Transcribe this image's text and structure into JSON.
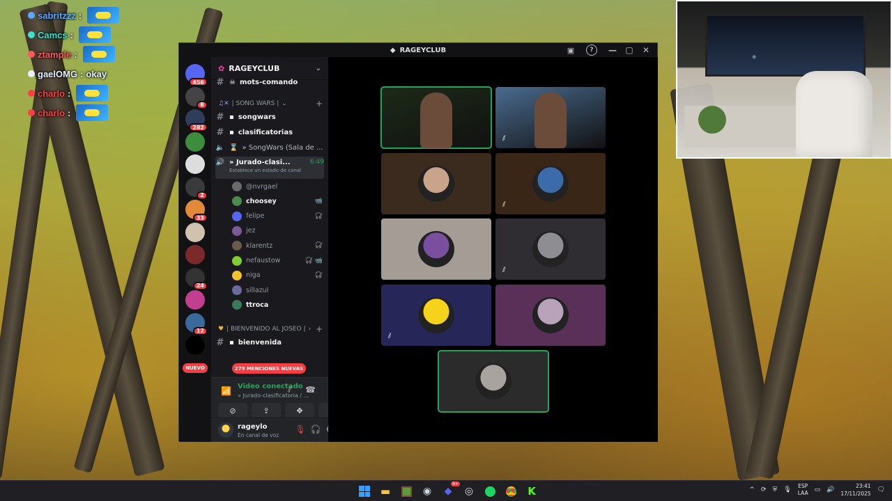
{
  "overlay_chat": [
    {
      "user": "sabritzzz",
      "message": "",
      "emote": true,
      "color": "#5aa8ff"
    },
    {
      "user": "Camcs",
      "message": "",
      "emote": true,
      "color": "#3fe0d0"
    },
    {
      "user": "ztample",
      "message": "",
      "emote": true,
      "color": "#ff5a5a"
    },
    {
      "user": "gaelOMG",
      "message": "okay",
      "emote": false,
      "color": "#e6f0ff"
    },
    {
      "user": "charlo",
      "message": "",
      "emote": true,
      "color": "#ff4040"
    },
    {
      "user": "charlo",
      "message": "",
      "emote": true,
      "color": "#ff4040"
    }
  ],
  "window": {
    "title": "RAGEYCLUB"
  },
  "servers": [
    {
      "badge": "456"
    },
    {
      "badge": "8"
    },
    {
      "badge": "282"
    },
    {
      "badge": ""
    },
    {
      "badge": ""
    },
    {
      "badge": "2"
    },
    {
      "badge": "33"
    },
    {
      "badge": ""
    },
    {
      "badge": ""
    },
    {
      "badge": "24"
    },
    {
      "badge": ""
    },
    {
      "badge": "12"
    },
    {
      "badge": ""
    }
  ],
  "new_label": "NUEVO",
  "guild": {
    "name": "RAGEYCLUB"
  },
  "channels": {
    "mots": "mots-comando",
    "cat_songwars": "| SONG WARS |",
    "songwars": "songwars",
    "clasificatorias": "clasificatorias",
    "songwars_sala": "» SongWars (Sala de ...",
    "jurado": "» Jurado-clasi...",
    "jurado_time": "6:49",
    "jurado_status": "Establece un estado de canal",
    "cat_bienvenido": "| BIENVENIDO AL JOSEO |",
    "bienvenida": "bienvenida"
  },
  "voice_users": [
    {
      "name": "@nvrgael",
      "on": false,
      "icons": ""
    },
    {
      "name": "choosey",
      "on": true,
      "icons": "📹"
    },
    {
      "name": "felipe",
      "on": false,
      "icons": "🎧̸"
    },
    {
      "name": "jez",
      "on": false,
      "icons": ""
    },
    {
      "name": "klarentz",
      "on": false,
      "icons": "🎧̸"
    },
    {
      "name": "nefaustow",
      "on": false,
      "icons": "🎧̸ 📹"
    },
    {
      "name": "niga",
      "on": false,
      "icons": "🎧̸"
    },
    {
      "name": "sillazul",
      "on": false,
      "icons": ""
    },
    {
      "name": "ttroca",
      "on": true,
      "icons": ""
    }
  ],
  "mentions_label": "279 MENCIONES NUEVAS",
  "voice_panel": {
    "title": "Video conectado",
    "subtitle": "» Jurado-clasificatoria / ..."
  },
  "user": {
    "name": "rageylo",
    "status": "En canal de voz"
  },
  "tiles": [
    {
      "name": "cam-1",
      "speaking": true,
      "muted": false,
      "bg": "#1d2a18",
      "avatar": ""
    },
    {
      "name": "cam-2",
      "speaking": false,
      "muted": true,
      "bg": "#4a6b8f",
      "avatar": ""
    },
    {
      "name": "tile-3",
      "speaking": false,
      "muted": false,
      "bg": "#3b2a1e",
      "avatar": "#c9a48a"
    },
    {
      "name": "tile-4",
      "speaking": false,
      "muted": true,
      "bg": "#3a2616",
      "avatar": "#3d6aa8"
    },
    {
      "name": "tile-5",
      "speaking": false,
      "muted": false,
      "bg": "#a59d95",
      "avatar": "#7b4fa0"
    },
    {
      "name": "tile-6",
      "speaking": false,
      "muted": true,
      "bg": "#2f2d31",
      "avatar": "#8d8d92"
    },
    {
      "name": "tile-7",
      "speaking": false,
      "muted": true,
      "bg": "#262659",
      "avatar": "#f6d31b"
    },
    {
      "name": "tile-8",
      "speaking": false,
      "muted": false,
      "bg": "#5a2f58",
      "avatar": "#b9a3ba"
    },
    {
      "name": "tile-9",
      "speaking": true,
      "muted": false,
      "bg": "#2b2b2b",
      "avatar": "#a8a39e"
    }
  ],
  "taskbar": {
    "lang": "ESP",
    "layout": "LAA",
    "time": "23:41",
    "date": "17/11/2025",
    "discord_badge": "9+"
  },
  "colors": {
    "accent_green": "#23a55a",
    "mention_red": "#f23f43",
    "blurple": "#5865f2"
  }
}
